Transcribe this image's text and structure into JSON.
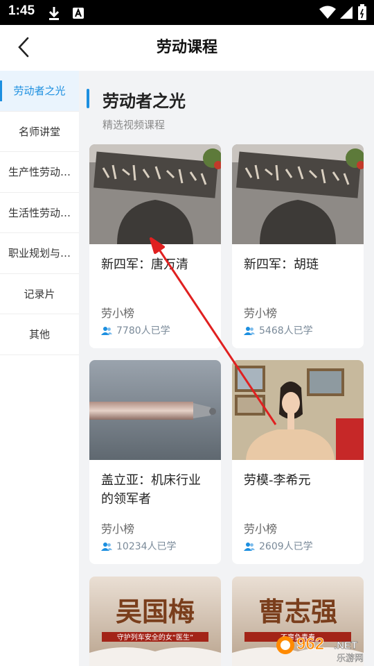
{
  "status": {
    "time": "1:45"
  },
  "header": {
    "title": "劳动课程"
  },
  "sidebar": {
    "items": [
      {
        "label": "劳动者之光"
      },
      {
        "label": "名师讲堂"
      },
      {
        "label": "生产性劳动…"
      },
      {
        "label": "生活性劳动…"
      },
      {
        "label": "职业规划与…"
      },
      {
        "label": "记录片"
      },
      {
        "label": "其他"
      }
    ]
  },
  "section": {
    "title": "劳动者之光",
    "subtitle": "精选视频课程"
  },
  "cards": [
    {
      "title": "新四军：唐万清",
      "author": "劳小榜",
      "learners": "7780人已学"
    },
    {
      "title": "新四军：胡琏",
      "author": "劳小榜",
      "learners": "5468人已学"
    },
    {
      "title": "盖立亚：机床行业的领军者",
      "author": "劳小榜",
      "learners": "10234人已学"
    },
    {
      "title": "劳模-李希元",
      "author": "劳小榜",
      "learners": "2609人已学"
    }
  ],
  "bottom_cards": [
    {
      "image_text": "吴国梅",
      "caption": "守护列车安全的女“医生”"
    },
    {
      "image_text": "曹志强",
      "caption": "不辜负青春"
    }
  ],
  "watermark": {
    "brand": "962",
    "brand_suffix": ".NET",
    "site": "乐游网"
  },
  "colors": {
    "accent": "#1c8fe0",
    "sidebar_active_bg": "#eaf4fd",
    "annotation_arrow": "#e02020"
  }
}
